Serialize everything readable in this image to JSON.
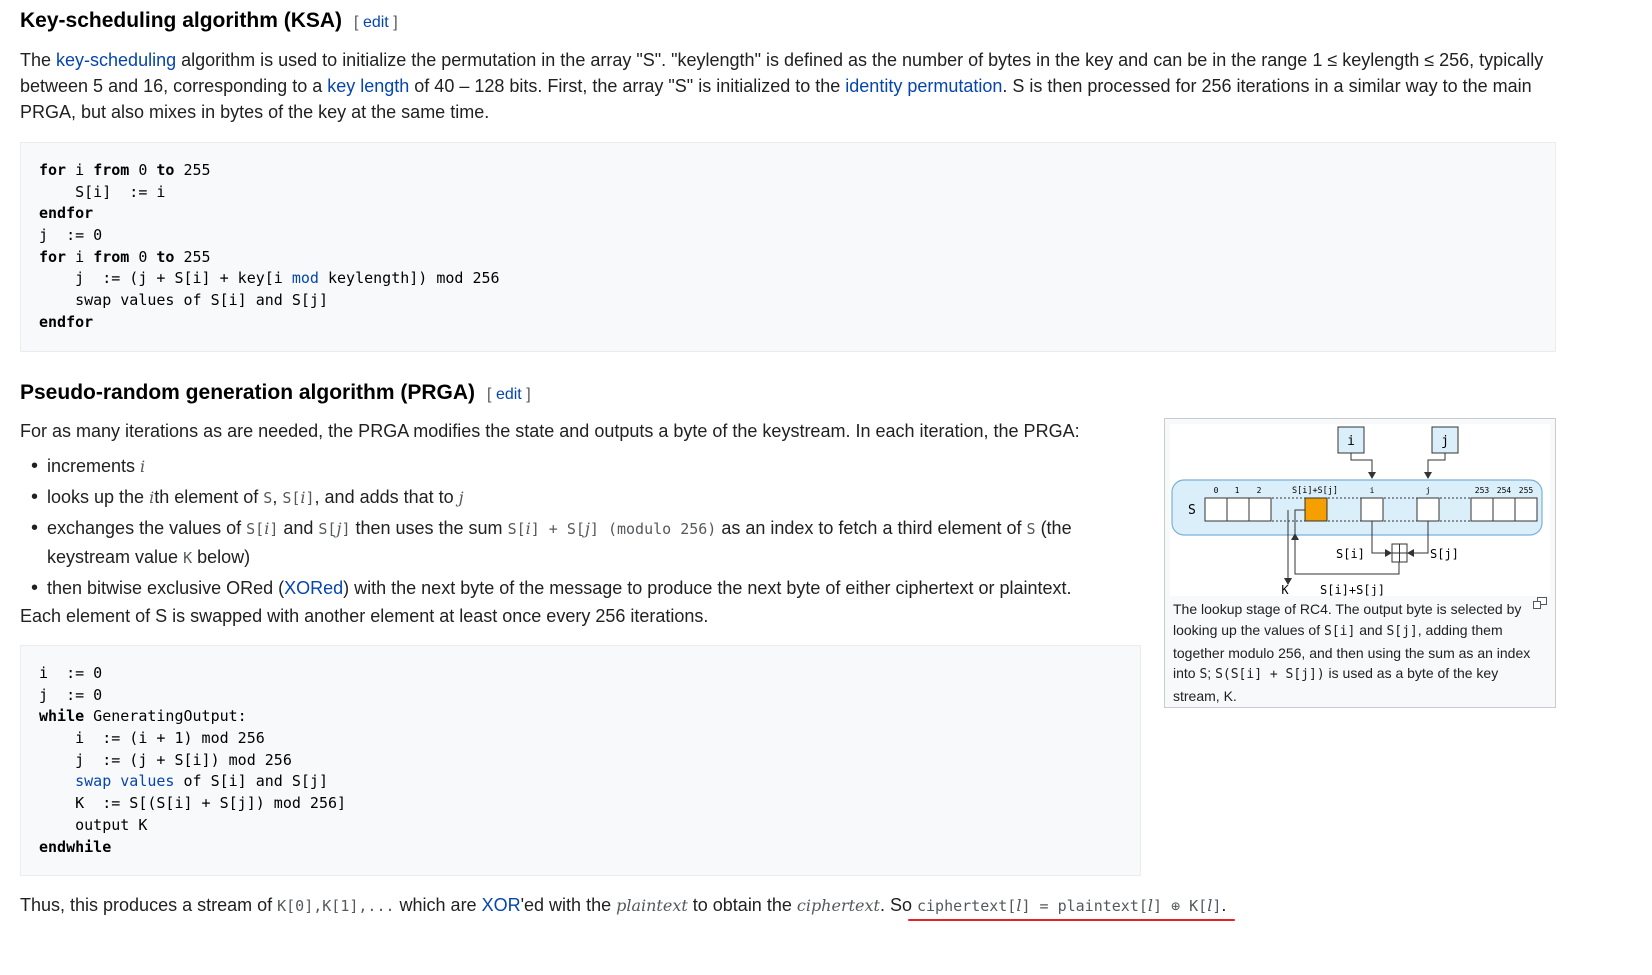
{
  "ksa": {
    "heading": "Key-scheduling algorithm (KSA)",
    "edit": {
      "open": "[",
      "label": "edit",
      "close": "]"
    },
    "p1": "The ",
    "link_key_scheduling": "key-scheduling",
    "p2": " algorithm is used to initialize the permutation in the array \"S\". \"keylength\" is defined as the number of bytes in the key and can be in the range 1 ≤ keylength ≤ 256, typically between 5 and 16, corresponding to a ",
    "link_key_length": "key length",
    "p3": " of 40 – 128 bits. First, the array \"S\" is initialized to the ",
    "link_identity_perm": "identity permutation",
    "p4": ". S is then processed for 256 iterations in a similar way to the main PRGA, but also mixes in bytes of the key at the same time.",
    "code": {
      "l1_kw1": "for",
      "l1_a": " i ",
      "l1_kw2": "from",
      "l1_b": " 0 ",
      "l1_kw3": "to",
      "l1_c": " 255",
      "l2": "    S[i]  := i",
      "l3": "endfor",
      "l4": "j  := 0",
      "l5_kw1": "for",
      "l5_a": " i ",
      "l5_kw2": "from",
      "l5_b": " 0 ",
      "l5_kw3": "to",
      "l5_c": " 255",
      "l6_a": "    j  := (j + S[i] + key[i ",
      "l6_mod": "mod",
      "l6_b": " keylength]) mod 256",
      "l7": "    swap values of S[i] and S[j]",
      "l8": "endfor"
    }
  },
  "prga": {
    "heading": "Pseudo-random generation algorithm (PRGA)",
    "edit": {
      "open": "[",
      "label": "edit",
      "close": "]"
    },
    "intro": "For as many iterations as are needed, the PRGA modifies the state and outputs a byte of the keystream. In each iteration, the PRGA:",
    "b1_text": "increments ",
    "b1_var": "i",
    "b2_a": "looks up the ",
    "b2_var": "i",
    "b2_b": "th element of ",
    "b2_S": "S",
    "b2_c": ", ",
    "b2_Si": "S[",
    "b2_Si_var": "i",
    "b2_Si_close": "]",
    "b2_d": ", and adds that to ",
    "b2_j": "j",
    "b3_a": "exchanges the values of ",
    "b3_Si": "S[",
    "b3_Si_var": "i",
    "b3_Si_close": "]",
    "b3_and": " and ",
    "b3_Sj": "S[",
    "b3_Sj_var": "j",
    "b3_Sj_close": "]",
    "b3_b": " then uses the sum ",
    "b3_sum1": "S[",
    "b3_sum1_var": "i",
    "b3_sum_mid": "] + S[",
    "b3_sum2_var": "j",
    "b3_sum_close": "]",
    "b3_mod": " (modulo 256)",
    "b3_c": " as an index to fetch a third element of ",
    "b3_S": "S",
    "b3_d": " (the keystream value ",
    "b3_K": "K",
    "b3_e": " below)",
    "b4_a": "then bitwise exclusive ORed (",
    "b4_link": "XORed",
    "b4_b": ") with the next byte of the message to produce the next byte of either ciphertext or plaintext.",
    "after": "Each element of S is swapped with another element at least once every 256 iterations.",
    "code": {
      "l1": "i  := 0",
      "l2": "j  := 0",
      "l3_kw": "while",
      "l3_rest": " GeneratingOutput:",
      "l4": "    i  := (i + 1) mod 256",
      "l5": "    j  := (j + S[i]) mod 256",
      "l6_ind": "    ",
      "l6_link": "swap values",
      "l6_rest": " of S[i] and S[j]",
      "l7": "    K  := S[(S[i] + S[j]) mod 256]",
      "l8": "    output K",
      "l9": "endwhile"
    },
    "figure": {
      "label_i": "i",
      "label_j": "j",
      "label_S": "S",
      "idx_0": "0",
      "idx_1": "1",
      "idx_2": "2",
      "idx_sum": "S[i]+S[j]",
      "idx_i": "i",
      "idx_j": "j",
      "idx_253": "253",
      "idx_254": "254",
      "idx_255": "255",
      "lbl_Si": "S[i]",
      "lbl_Sj": "S[j]",
      "lbl_K": "K",
      "lbl_sum": "S[i]+S[j]",
      "highlight_color": "#f5a000",
      "frame_color": "#dbeffa",
      "caption_a": "The lookup stage of RC4. The output byte is selected by looking up the values of ",
      "cap_Si": "S[i]",
      "caption_b": " and ",
      "cap_Sj": "S[j]",
      "caption_c": ", adding them together modulo 256, and then using the sum as an index into ",
      "cap_S": "S",
      "caption_d": "; ",
      "cap_expr": "S(S[i] + S[j])",
      "caption_e": " is used as a byte of the key stream, K."
    }
  },
  "final": {
    "a": "Thus, this produces a stream of ",
    "k_seq": "K[0],K[1],...",
    "b": " which are ",
    "xor_link": "XOR",
    "c": "'ed with the ",
    "plaintext_var": "plaintext",
    "d": " to obtain the ",
    "ciphertext_var": "ciphertext",
    "e": ". So ",
    "eq_a": "ciphertext[",
    "eq_l1": "l",
    "eq_b": "] = plaintext[",
    "eq_l2": "l",
    "eq_c": "] ⊕ K[",
    "eq_l3": "l",
    "eq_d": "]",
    "f": "."
  },
  "colors": {
    "link": "#0645ad",
    "highlight_underline": "#e8202a",
    "code_bg": "#f8f9fa"
  }
}
